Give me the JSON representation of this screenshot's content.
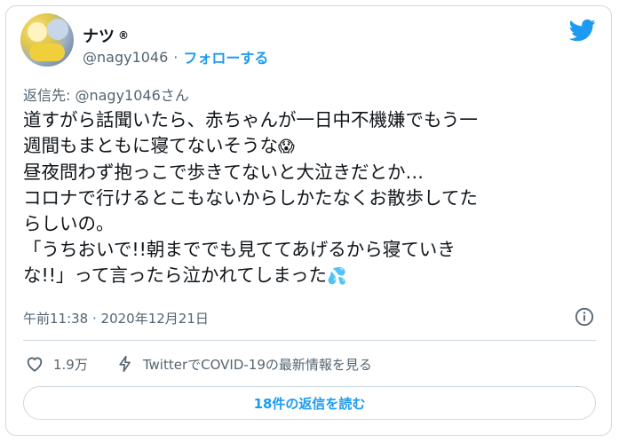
{
  "header": {
    "display_name": "ナツ",
    "badge": "®",
    "handle": "@nagy1046",
    "separator": "·",
    "follow_label": "フォローする"
  },
  "tweet": {
    "reply_to": "返信先: @nagy1046さん",
    "lines": [
      "道すがら話聞いたら、赤ちゃんが一日中不機嫌でもう一",
      "週間もまともに寝てないそうな",
      "昼夜問わず抱っこで歩きてないと大泣きだとか…",
      "コロナで行けるとこもないからしかたなくお散歩してた",
      "らしいの。",
      "「うちおいで!!朝まででも見ててあげるから寝ていき",
      "な!!」って言ったら泣かれてしまった"
    ],
    "emoji_scream": "😱",
    "emoji_sweat": "💦",
    "timestamp": "午前11:38 · 2020年12月21日"
  },
  "actions": {
    "like_count": "1.9万",
    "covid_label": "TwitterでCOVID-19の最新情報を見る"
  },
  "replies_button": "18件の返信を読む",
  "colors": {
    "accent": "#1d9bf0",
    "secondary_text": "#536471",
    "border": "#cfd9de"
  },
  "icons": [
    "twitter-bird-icon",
    "info-icon",
    "heart-icon",
    "lightning-icon"
  ]
}
